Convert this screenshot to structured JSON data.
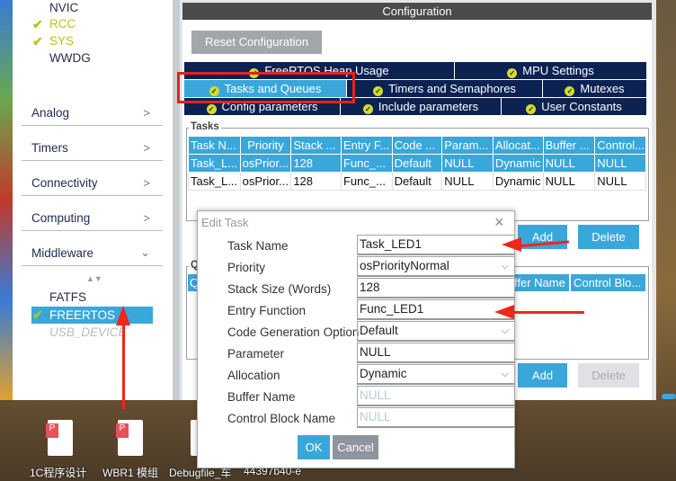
{
  "sidebar": {
    "peripherals": [
      {
        "label": "NVIC",
        "checked": false
      },
      {
        "label": "RCC",
        "checked": true
      },
      {
        "label": "SYS",
        "checked": true
      },
      {
        "label": "WWDG",
        "checked": false
      }
    ],
    "categories": [
      {
        "label": "Analog",
        "chevron": "chevron-right"
      },
      {
        "label": "Timers",
        "chevron": "chevron-right"
      },
      {
        "label": "Connectivity",
        "chevron": "chevron-right"
      },
      {
        "label": "Computing",
        "chevron": "chevron-right"
      },
      {
        "label": "Middleware",
        "chevron": "chevron-down"
      }
    ],
    "middleware": [
      {
        "label": "FATFS",
        "checked": false,
        "selected": false
      },
      {
        "label": "FREERTOS",
        "checked": true,
        "selected": true
      },
      {
        "label": "USB_DEVICE",
        "checked": false,
        "disabled": true
      }
    ]
  },
  "config": {
    "title": "Configuration",
    "reset_label": "Reset Configuration",
    "tabs_row1": [
      "FreeRTOS Heap Usage",
      "MPU Settings"
    ],
    "tabs_row2": [
      "Tasks and Queues",
      "Timers and Semaphores",
      "Mutexes"
    ],
    "tabs_row3": [
      "Config parameters",
      "Include parameters",
      "User Constants"
    ],
    "active_tab": "Tasks and Queues",
    "tasks": {
      "label": "Tasks",
      "columns": [
        "Task N...",
        "Priority",
        "Stack ...",
        "Entry F...",
        "Code ...",
        "Param...",
        "Allocat...",
        "Buffer ...",
        "Control..."
      ],
      "rows": [
        [
          "Task_L...",
          "osPrior...",
          "128",
          "Func_...",
          "Default",
          "NULL",
          "Dynamic",
          "NULL",
          "NULL"
        ],
        [
          "Task_L...",
          "osPrior...",
          "128",
          "Func_...",
          "Default",
          "NULL",
          "Dynamic",
          "NULL",
          "NULL"
        ]
      ],
      "add_label": "Add",
      "delete_label": "Delete"
    },
    "queues": {
      "label": "Q",
      "columns_visible": [
        "Q",
        "ffer Name",
        "Control Blo..."
      ],
      "add_label": "Add",
      "delete_label": "Delete"
    }
  },
  "dialog": {
    "title": "Edit Task",
    "fields": [
      {
        "label": "Task Name",
        "value": "Task_LED1",
        "type": "text"
      },
      {
        "label": "Priority",
        "value": "osPriorityNormal",
        "type": "select"
      },
      {
        "label": "Stack Size (Words)",
        "value": "128",
        "type": "text"
      },
      {
        "label": "Entry Function",
        "value": "Func_LED1",
        "type": "text"
      },
      {
        "label": "Code Generation Option",
        "value": "Default",
        "type": "select"
      },
      {
        "label": "Parameter",
        "value": "NULL",
        "type": "text"
      },
      {
        "label": "Allocation",
        "value": "Dynamic",
        "type": "select"
      },
      {
        "label": "Buffer Name",
        "value": "NULL",
        "type": "placeholder"
      },
      {
        "label": "Control Block Name",
        "value": "NULL",
        "type": "placeholder"
      }
    ],
    "ok_label": "OK",
    "cancel_label": "Cancel"
  },
  "desktop": {
    "icons": [
      {
        "label": "1C程序设计",
        "type": "pdf"
      },
      {
        "label": "WBR1 模组",
        "type": "pdf"
      },
      {
        "label": "Debugfile_车",
        "type": "file"
      },
      {
        "label": "44397b40-e",
        "type": "file"
      }
    ]
  },
  "colors": {
    "accent": "#3aa7da",
    "tab_bg": "#0c2252",
    "check": "#b7c418",
    "annotation": "#f0261a"
  }
}
